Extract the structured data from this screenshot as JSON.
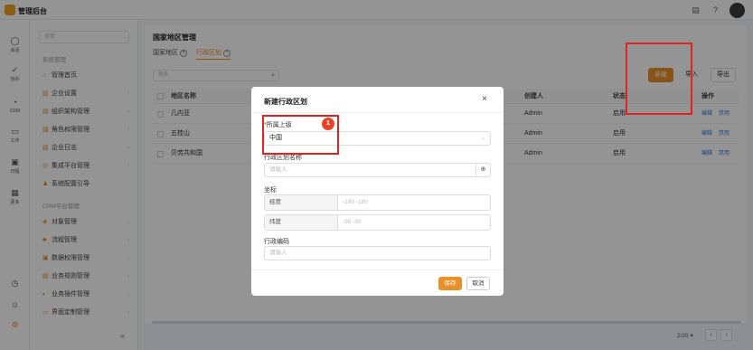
{
  "app": {
    "title": "管理后台"
  },
  "topbar": {
    "icons": [
      "doc-icon",
      "help-icon",
      "avatar"
    ]
  },
  "rail": {
    "items": [
      {
        "icon": "chat-icon",
        "label": "会话"
      },
      {
        "icon": "check-icon",
        "label": "协办"
      },
      {
        "icon": "crm-icon",
        "label": "CRM"
      },
      {
        "icon": "briefcase-icon",
        "label": "工作"
      },
      {
        "icon": "calendar-icon",
        "label": "日程"
      },
      {
        "icon": "grid-icon",
        "label": "更多"
      }
    ],
    "bottom_icons": [
      "clock-icon",
      "contacts-icon",
      "settings-icon"
    ]
  },
  "sidebar": {
    "search_placeholder": "搜索",
    "group1": "系统管理",
    "items1": [
      "管理首页",
      "企业设置",
      "组织架构管理",
      "角色权限管理",
      "企业日志",
      "集成平台管理",
      "系统配置引导"
    ],
    "group2": "CRM平台管理",
    "items2": [
      "对象管理",
      "流程管理",
      "数据权限管理",
      "业务规则管理",
      "业务插件管理",
      "界面定制管理"
    ],
    "collapse": "«"
  },
  "main": {
    "title": "国家地区管理",
    "tabs": [
      {
        "label": "国家地区",
        "help": "?"
      },
      {
        "label": "行政区划",
        "help": "?"
      }
    ],
    "search_placeholder": "搜索",
    "buttons": {
      "new": "新建",
      "import": "导入",
      "export": "导出"
    },
    "table": {
      "headers": {
        "name": "地区名称",
        "creator": "创建人",
        "status": "状态",
        "actions": "操作"
      },
      "rows": [
        {
          "name": "几内亚",
          "creator": "Admin",
          "status": "启用",
          "edit": "编辑",
          "disable": "禁用"
        },
        {
          "name": "五桂山",
          "creator": "Admin",
          "status": "启用",
          "edit": "编辑",
          "disable": "禁用"
        },
        {
          "name": "贝劳共和国",
          "creator": "Admin",
          "status": "启用",
          "edit": "编辑",
          "disable": "禁用"
        }
      ]
    },
    "pagination": {
      "page_size": "2/20 ▾",
      "prev": "‹",
      "next": "›"
    }
  },
  "modal": {
    "title": "新建行政区划",
    "close": "×",
    "parent_label": "所属上级",
    "parent_value": "中国",
    "name_label": "行政区划名称",
    "name_placeholder": "请输入",
    "coord_label": "坐标",
    "lng_label": "经度",
    "lng_placeholder": "-180 -180",
    "lat_label": "纬度",
    "lat_placeholder": "-90 -90",
    "code_label": "行政编码",
    "code_placeholder": "请输入",
    "save": "保存",
    "cancel": "取消"
  },
  "annotation": {
    "badge": "1"
  },
  "colors": {
    "accent": "#e8902a",
    "highlight": "#e02424",
    "link": "#3a7bd5"
  }
}
